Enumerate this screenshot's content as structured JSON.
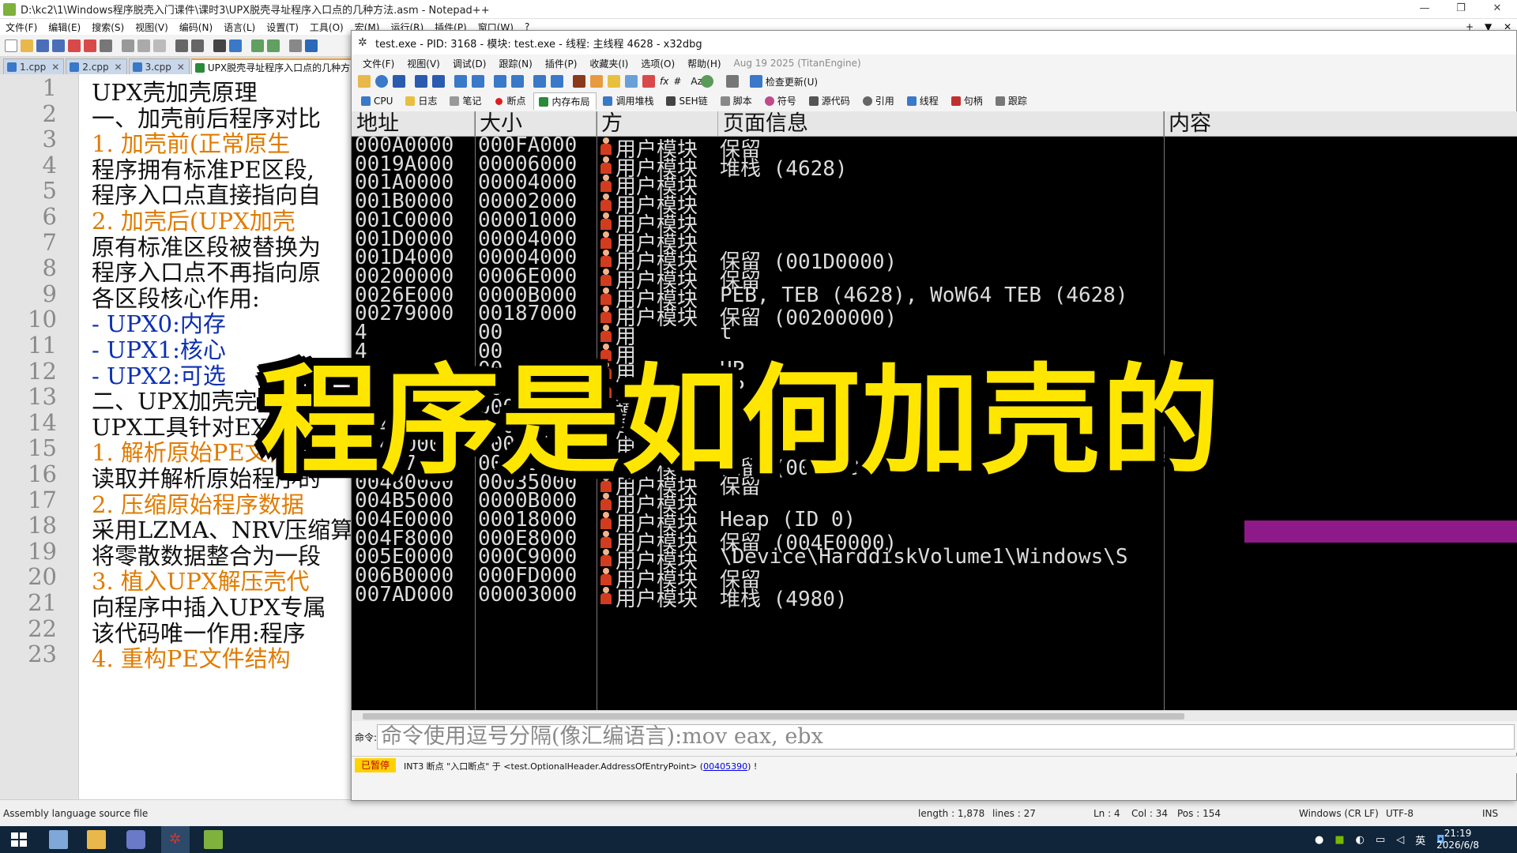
{
  "npp": {
    "title": "D:\\kc2\\1\\Windows程序脱壳入门课件\\课时3\\UPX脱壳寻址程序入口点的几种方法.asm - Notepad++",
    "window_controls": [
      "—",
      "❐",
      "✕"
    ],
    "inner_controls": [
      "+",
      "▼",
      "✕"
    ],
    "menu": [
      "文件(F)",
      "编辑(E)",
      "搜索(S)",
      "视图(V)",
      "编码(N)",
      "语言(L)",
      "设置(T)",
      "工具(O)",
      "宏(M)",
      "运行(R)",
      "插件(P)",
      "窗口(W)",
      "?"
    ],
    "tabs": [
      {
        "label": "1.cpp",
        "close": "✕"
      },
      {
        "label": "2.cpp",
        "close": "✕"
      },
      {
        "label": "3.cpp",
        "close": "✕"
      },
      {
        "label": "UPX脱壳寻址程序入口点的几种方法",
        "close": ""
      }
    ],
    "line_numbers": [
      "1",
      "2",
      "3",
      "4",
      "5",
      "6",
      "7",
      "8",
      "9",
      "10",
      "11",
      "12",
      "13",
      "14",
      "15",
      "16",
      "17",
      "18",
      "19",
      "20",
      "21",
      "22",
      "23"
    ],
    "lines": [
      {
        "text": "UPX壳加壳原理",
        "style": ""
      },
      {
        "text": "一、加壳前后程序对比",
        "style": ""
      },
      {
        "text": "1. 加壳前(正常原生",
        "style": "orange"
      },
      {
        "text": "程序拥有标准PE区段,",
        "style": ""
      },
      {
        "text": "程序入口点直接指向自",
        "style": ""
      },
      {
        "text": "2. 加壳后(UPX加壳",
        "style": "orange"
      },
      {
        "text": "原有标准区段被替换为",
        "style": ""
      },
      {
        "text": "程序入口点不再指向原",
        "style": ""
      },
      {
        "text": "各区段核心作用:",
        "style": ""
      },
      {
        "text": "- UPX0:内存",
        "style": "blue"
      },
      {
        "text": "- UPX1:核心",
        "style": "blue"
      },
      {
        "text": "- UPX2:可选",
        "style": "blue"
      },
      {
        "text": "二、UPX加壳完整",
        "style": ""
      },
      {
        "text": "UPX工具针对EXE、DL",
        "style": ""
      },
      {
        "text": "1. 解析原始PE文件",
        "style": "orange"
      },
      {
        "text": "读取并解析原始程序的",
        "style": ""
      },
      {
        "text": "2. 压缩原始程序数据",
        "style": "orange"
      },
      {
        "text": "采用LZMA、NRV压缩算",
        "style": ""
      },
      {
        "text": "将零散数据整合为一段",
        "style": ""
      },
      {
        "text": "3. 植入UPX解压壳代",
        "style": "orange"
      },
      {
        "text": "向程序中插入UPX专属",
        "style": ""
      },
      {
        "text": "该代码唯一作用:程序",
        "style": ""
      },
      {
        "text": "4. 重构PE文件结构",
        "style": "orange"
      }
    ],
    "status": {
      "file_type": "Assembly language source file",
      "length": "length : 1,878",
      "lines": "lines : 27",
      "ln": "Ln : 4",
      "col": "Col : 34",
      "pos": "Pos : 154",
      "eol": "Windows (CR LF)",
      "encoding": "UTF-8",
      "mode": "INS"
    }
  },
  "dbg": {
    "title": "test.exe - PID: 3168 - 模块: test.exe - 线程: 主线程 4628 - x32dbg",
    "menu": [
      "文件(F)",
      "视图(V)",
      "调试(D)",
      "跟踪(N)",
      "插件(P)",
      "收藏夹(I)",
      "选项(O)",
      "帮助(H)"
    ],
    "version": "Aug 19 2025 (TitanEngine)",
    "toolbar_glyphs": [
      "fx",
      "#",
      "Az"
    ],
    "check_update": "检查更新(U)",
    "tabs": [
      "CPU",
      "日志",
      "笔记",
      "断点",
      "内存布局",
      "调用堆栈",
      "SEH链",
      "脚本",
      "符号",
      "源代码",
      "引用",
      "线程",
      "句柄",
      "跟踪"
    ],
    "active_tab": "内存布局",
    "columns": [
      "地址",
      "大小",
      "方",
      "页面信息",
      "内容"
    ],
    "rows": [
      {
        "addr": "000A0000",
        "size": "000FA000",
        "party": "用户模块",
        "info": "保留"
      },
      {
        "addr": "0019A000",
        "size": "00006000",
        "party": "用户模块",
        "info": "堆栈 (4628)"
      },
      {
        "addr": "001A0000",
        "size": "00004000",
        "party": "用户模块",
        "info": ""
      },
      {
        "addr": "001B0000",
        "size": "00002000",
        "party": "用户模块",
        "info": ""
      },
      {
        "addr": "001C0000",
        "size": "00001000",
        "party": "用户模块",
        "info": ""
      },
      {
        "addr": "001D0000",
        "size": "00004000",
        "party": "用户模块",
        "info": ""
      },
      {
        "addr": "001D4000",
        "size": "00004000",
        "party": "用户模块",
        "info": "保留 (001D0000)"
      },
      {
        "addr": "00200000",
        "size": "0006E000",
        "party": "用户模块",
        "info": "保留"
      },
      {
        "addr": "0026E000",
        "size": "0000B000",
        "party": "用户模块",
        "info": "PEB, TEB (4628), WoW64 TEB (4628)"
      },
      {
        "addr": "00279000",
        "size": "00187000",
        "party": "用户模块",
        "info": "保留 (00200000)"
      },
      {
        "addr": "4",
        "size": "00",
        "party": "用",
        "info": "t"
      },
      {
        "addr": "4",
        "size": "00",
        "party": "用",
        "info": ""
      },
      {
        "addr": "4",
        "size": "00",
        "party": "用",
        "info": "UP"
      },
      {
        "addr": "4",
        "size": "00",
        "party": "用",
        "info": "UP"
      },
      {
        "addr": "0",
        "size": "000",
        "party": "模块",
        "info": "保留"
      },
      {
        "addr": "00445000",
        "size": "0000B000",
        "party": "用户模块",
        "info": ""
      },
      {
        "addr": "00470000",
        "size": "00007000",
        "party": "用户模块",
        "info": ""
      },
      {
        "addr": "00477000",
        "size": "00009000",
        "party": "用户模块",
        "info": "保留 (00470000)"
      },
      {
        "addr": "00480000",
        "size": "00035000",
        "party": "用户模块",
        "info": "保留"
      },
      {
        "addr": "004B5000",
        "size": "0000B000",
        "party": "用户模块",
        "info": ""
      },
      {
        "addr": "004E0000",
        "size": "00018000",
        "party": "用户模块",
        "info": "Heap (ID 0)"
      },
      {
        "addr": "004F8000",
        "size": "000E8000",
        "party": "用户模块",
        "info": "保留 (004E0000)"
      },
      {
        "addr": "005E0000",
        "size": "000C9000",
        "party": "用户模块",
        "info": "\\Device\\HarddiskVolume1\\Windows\\S"
      },
      {
        "addr": "006B0000",
        "size": "000FD000",
        "party": "用户模块",
        "info": "保留"
      },
      {
        "addr": "007AD000",
        "size": "00003000",
        "party": "用户模块",
        "info": "堆栈 (4980)"
      }
    ],
    "cmd_label": "命令:",
    "cmd_placeholder": "命令使用逗号分隔(像汇编语言):mov eax, ebx",
    "status_paused": "已暂停",
    "status_msg_pre": "INT3 断点 \"入口断点\" 于 <test.OptionalHeader.AddressOfEntryPoint> (",
    "status_msg_link": "00405390",
    "status_msg_post": ") !"
  },
  "caption": "程序是如何加壳的",
  "taskbar": {
    "tray": [
      "英"
    ],
    "time": "21:19",
    "date": "2026/6/8"
  },
  "colors": {
    "caption": "#ffe600",
    "highlight_band": "#8e1a8a",
    "paused_bg": "#ffd200",
    "taskbar": "#10243a"
  }
}
